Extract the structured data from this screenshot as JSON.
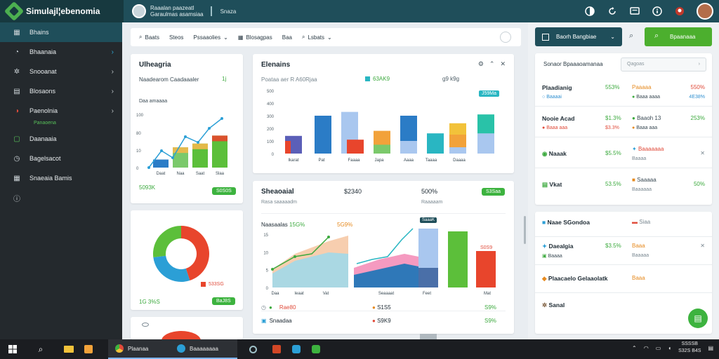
{
  "app": {
    "title": "Simulajl¦ebenomia",
    "user_line1": "Raaalan paazeatl",
    "user_line2": "Garaulmas asamsiaa",
    "status": "Snaza"
  },
  "sidebar": {
    "items": [
      {
        "label": "Bhains"
      },
      {
        "label": "Bhaanaia"
      },
      {
        "label": "Snooanat"
      },
      {
        "label": "Blosaons"
      },
      {
        "label": "Paenolnia"
      },
      {
        "label": "Daanaaia"
      },
      {
        "label": "Bagelsacot"
      },
      {
        "label": "Snaeaia Bamis"
      },
      {
        "label": ""
      }
    ],
    "sub_label": "Panaoena"
  },
  "toolbar": {
    "items": [
      "Baats",
      "Steos",
      "Pssaaolies",
      "Blosagpas",
      "Baa",
      "Lsbats"
    ]
  },
  "card1": {
    "title": "Ulheagria",
    "subtitle": "Naadearom Caadaaaler",
    "flag": "1j",
    "legend": "Daa amaaaa",
    "footer_value": "5093K",
    "badge": "S0S0S"
  },
  "card2": {
    "title": "Elenains",
    "subtitle": "Poataa aer R A60Rjaa",
    "legend1": "63AK9",
    "legend2": "g9 k9g",
    "tag": "J59Ma"
  },
  "card3": {
    "footer_value": "1G 3%S",
    "badge": "BaJ8S",
    "legend_value": "533SG"
  },
  "card4": {
    "title": "Sheaoaial",
    "value1": "$2340",
    "value2": "500%",
    "badge": "S3Saa",
    "sub1": "Rasa saaaaadm",
    "sub2": "Raaaaam",
    "tag1": "Naasaalas",
    "tag1v": "15G%",
    "tag2": "5G9%",
    "tag3": "SaaaK",
    "tag4": "S0S9",
    "rows": [
      {
        "a": "Rae80",
        "b": "S1S5",
        "c": "S9%"
      },
      {
        "a": "Snaadaa",
        "b": "S9K9",
        "c": "S9%"
      }
    ]
  },
  "chart_data": [
    {
      "type": "bar",
      "categories": [
        "Daat",
        "Naa",
        "Saat",
        "Slaa"
      ],
      "values": [
        15,
        38,
        45,
        60
      ],
      "ylim": [
        0,
        100
      ],
      "ytick_labels": [
        "0",
        "10",
        "80",
        "100"
      ]
    },
    {
      "type": "bar",
      "categories": [
        "Ikarat",
        "Pat",
        "Faaaa",
        "Japa",
        "Aaaa",
        "Taaaa",
        "Daaaa"
      ],
      "ytick_labels": [
        "0",
        "100",
        "200",
        "300",
        "400",
        "500"
      ],
      "ylim": [
        0,
        500
      ]
    },
    {
      "type": "pie",
      "values": [
        45,
        28,
        27
      ],
      "colors": [
        "#e8452c",
        "#2b9fd6",
        "#5cbf3a"
      ]
    },
    {
      "type": "area",
      "categories": [
        "Daa",
        "Ieaat",
        "Vat",
        "Seaaaat",
        "Feet",
        "Mat"
      ],
      "ytick_labels": [
        "0",
        "5",
        "10",
        "15"
      ],
      "ylim": [
        0,
        15
      ]
    }
  ],
  "right": {
    "select_label": "Baorh Bangbiae",
    "go_label": "Bpaanaaa",
    "search_label": "Sonaor Bpaaaoamanaa",
    "search_placeholder": "Qagoas",
    "rows": [
      {
        "name": "Plaadianig",
        "sub": "Baaaai",
        "v1": "553%",
        "v1b": "",
        "v2": "Paaaaa",
        "v2b": "Baaa aaaa",
        "v3": "550%",
        "v3b": "4E38%"
      },
      {
        "name": "Nooie Acad",
        "sub": "Baaa aaa",
        "v1": "$1.3%",
        "v1b": "$3.3%",
        "v2": "Baaoh 13",
        "v2b": "Baaa aaa",
        "v3": "253%",
        "v3b": ""
      },
      {
        "name": "Naaak",
        "sub": "",
        "v1": "$5.5%",
        "v1b": "",
        "v2": "Baaaaaaa",
        "v2b": "Baaaa",
        "v3": "",
        "v3b": ""
      },
      {
        "name": "Vkat",
        "sub": "",
        "v1": "53.5%",
        "v1b": "",
        "v2": "Saaaaa",
        "v2b": "Baaaaaa",
        "v3": "50%",
        "v3b": ""
      }
    ],
    "rows2": [
      {
        "name": "Naae SGondoa",
        "v2": "Siaa"
      },
      {
        "name": "Daealgia",
        "sub": "Baaaa",
        "v1": "$3.5%",
        "v2": "Baaa",
        "v2b": "Baaaaa"
      },
      {
        "name": "Plaacaelo Gelaaolatk",
        "v2": "Baaa"
      },
      {
        "name": "Sanal"
      }
    ]
  },
  "taskbar": {
    "apps": [
      {
        "label": "Plaanaa"
      },
      {
        "label": "Baaaaaaaa"
      }
    ],
    "clock_time": "SSSSB",
    "clock_date": "S32S B4S"
  }
}
